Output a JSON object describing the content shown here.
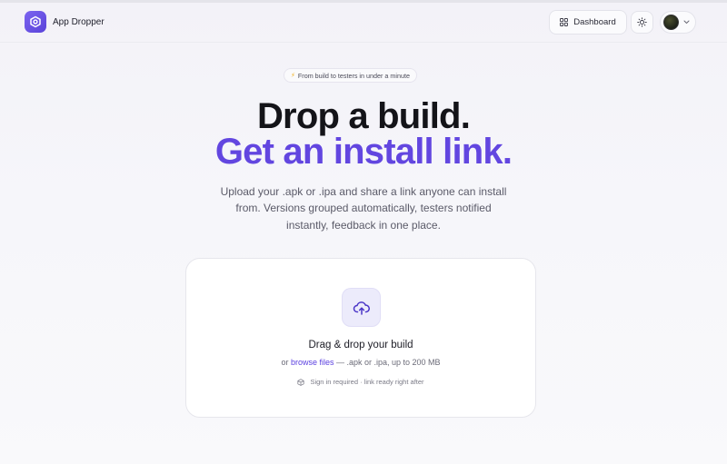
{
  "header": {
    "brand_name": "App Dropper",
    "dashboard_label": "Dashboard"
  },
  "hero": {
    "badge_text": "From build to testers in under a minute",
    "title_line1": "Drop a build.",
    "title_line2": "Get an install link.",
    "description": "Upload your .apk or .ipa and share a link anyone can install from. Versions grouped automatically, testers notified instantly, feedback in one place."
  },
  "dropzone": {
    "title": "Drag & drop your build",
    "sub_prefix": "or ",
    "browse_link": "browse files",
    "sub_suffix": " — .apk or .ipa, up to 200 MB",
    "note": "Sign in required · link ready right after"
  },
  "colors": {
    "accent": "#6246e0",
    "brand_gradient_start": "#7b64f0",
    "brand_gradient_end": "#5a43d9",
    "icon_tile_bg": "#ecebfb",
    "badge_bolt": "#f2b01e"
  },
  "icons": {
    "brand": "cube-logo-icon",
    "dashboard": "grid-icon",
    "theme": "sun-icon",
    "account_chevron": "chevron-down-icon",
    "upload": "cloud-upload-icon",
    "note": "package-icon",
    "badge": "bolt-icon"
  }
}
